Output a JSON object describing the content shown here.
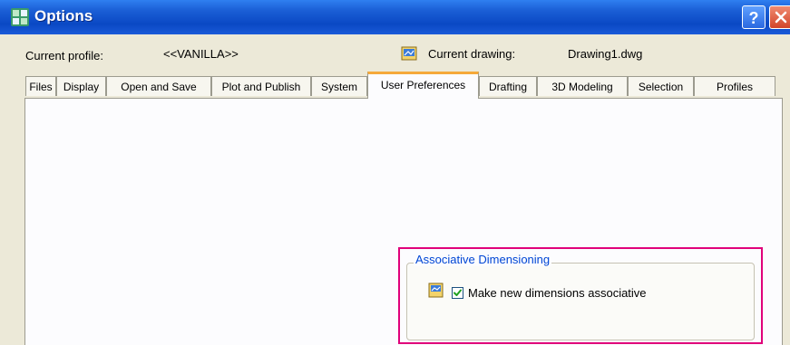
{
  "window": {
    "title": "Options",
    "help_label": "?"
  },
  "profile": {
    "current_profile_label": "Current profile:",
    "current_profile_value": "<<VANILLA>>",
    "current_drawing_label": "Current drawing:",
    "current_drawing_value": "Drawing1.dwg"
  },
  "tabs": [
    {
      "label": "Files"
    },
    {
      "label": "Display"
    },
    {
      "label": "Open and Save"
    },
    {
      "label": "Plot and Publish"
    },
    {
      "label": "System"
    },
    {
      "label": "User Preferences",
      "active": true
    },
    {
      "label": "Drafting"
    },
    {
      "label": "3D Modeling"
    },
    {
      "label": "Selection"
    },
    {
      "label": "Profiles"
    }
  ],
  "associative_dimensioning": {
    "group_title": "Associative Dimensioning",
    "checkbox_label": "Make new dimensions associative",
    "checked": true
  },
  "colors": {
    "titlebar": "#0a48c4",
    "active_tab_accent": "#f5a93a",
    "highlight_border": "#e0007a",
    "group_title": "#0046d5"
  }
}
